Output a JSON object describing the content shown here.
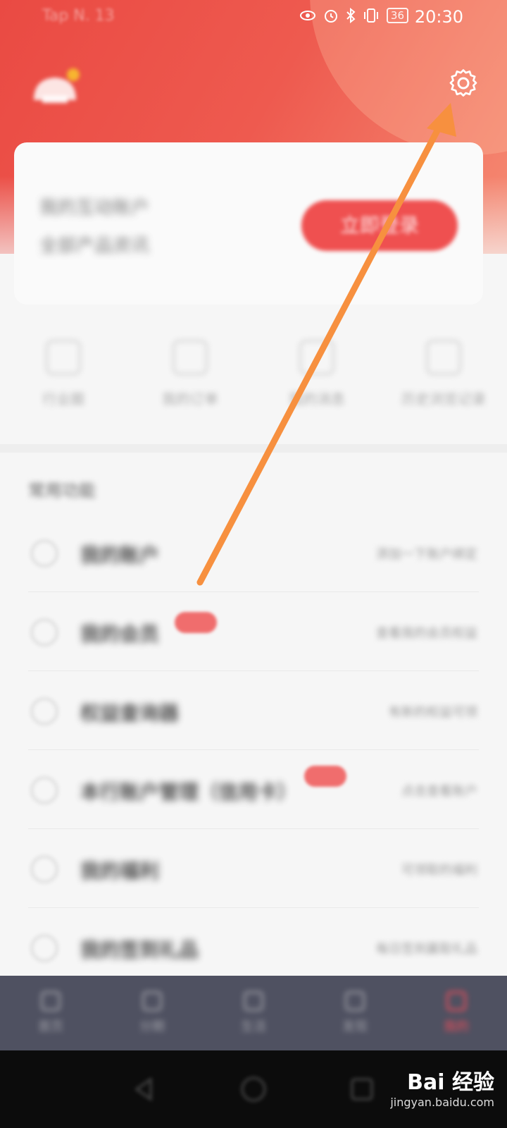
{
  "status_bar": {
    "carrier": "Tap N. 13",
    "battery": "36",
    "time": "20:30",
    "icons": [
      "eye-icon",
      "alarm-icon",
      "bluetooth-icon",
      "vibrate-icon",
      "battery-icon"
    ]
  },
  "header": {
    "settings_icon": "gear-icon"
  },
  "login_card": {
    "line1": "我的互动账户",
    "line2": "全部产品资讯",
    "login_button": "立即登录"
  },
  "quick_actions": [
    {
      "label": "行业圈",
      "icon": "cloud-icon"
    },
    {
      "label": "我的订单",
      "icon": "bag-icon"
    },
    {
      "label": "我的消息",
      "icon": "message-icon"
    },
    {
      "label": "历史浏览记录",
      "icon": "history-icon"
    }
  ],
  "section": {
    "title": "常用功能"
  },
  "list_items": [
    {
      "title": "我的账户",
      "desc": "添加一下账户绑定",
      "icon": "account-icon"
    },
    {
      "title": "我的会员",
      "desc": "查看我的会员权益",
      "icon": "vip-icon",
      "badge": true
    },
    {
      "title": "权益查询器",
      "desc": "有新的权益可领",
      "icon": "query-icon"
    },
    {
      "title": "本行账户管理（信用卡）",
      "desc": "点击查看账户",
      "icon": "card-icon",
      "badge": true
    },
    {
      "title": "我的福利",
      "desc": "可领取的福利",
      "icon": "gift-icon"
    },
    {
      "title": "我的签到礼品",
      "desc": "每日签到赢取礼品",
      "icon": "checkin-icon"
    }
  ],
  "bottom_nav": [
    {
      "label": "首页",
      "icon": "home-icon",
      "active": false
    },
    {
      "label": "分期",
      "icon": "installment-icon",
      "active": false
    },
    {
      "label": "生活",
      "icon": "life-icon",
      "active": false
    },
    {
      "label": "发现",
      "icon": "discover-icon",
      "active": false
    },
    {
      "label": "我的",
      "icon": "user-icon",
      "active": true
    }
  ],
  "system_nav": [
    "back-icon",
    "home-icon",
    "recents-icon"
  ],
  "watermark": {
    "main": "Bai 经验",
    "sub": "jingyan.baidu.com"
  },
  "colors": {
    "header": "#ea4a43",
    "accent": "#ef5050",
    "arrow": "#f7903f",
    "nav_bg": "#4f5161"
  }
}
